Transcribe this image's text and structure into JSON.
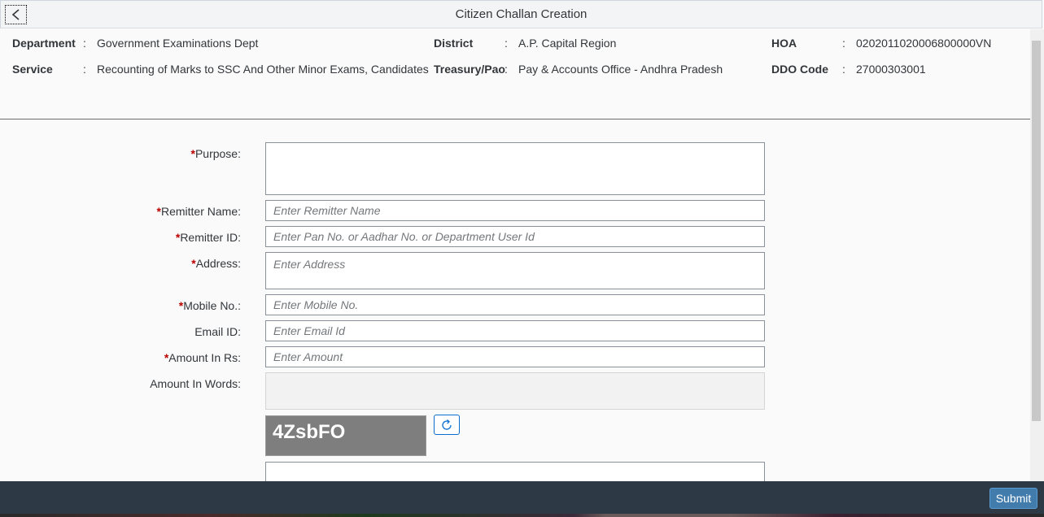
{
  "header": {
    "title": "Citizen Challan Creation"
  },
  "info": {
    "department": {
      "label": "Department",
      "value": "Government Examinations Dept"
    },
    "service": {
      "label": "Service",
      "value": "Recounting of Marks to SSC And Other Minor Exams, Candidates"
    },
    "district": {
      "label": "District",
      "value": "A.P. Capital Region"
    },
    "treasury": {
      "label": "Treasury/Pao",
      "value": "Pay & Accounts Office - Andhra Pradesh"
    },
    "hoa": {
      "label": "HOA",
      "value": "0202011020006800000VN"
    },
    "ddo": {
      "label": "DDO Code",
      "value": "27000303001"
    },
    "separator": ":"
  },
  "form": {
    "required_mark": "*",
    "purpose": {
      "label": "Purpose:",
      "value": "",
      "placeholder": ""
    },
    "remitter_name": {
      "label": "Remitter Name:",
      "value": "",
      "placeholder": "Enter Remitter Name"
    },
    "remitter_id": {
      "label": "Remitter ID:",
      "value": "",
      "placeholder": "Enter Pan No. or Aadhar No. or Department User Id"
    },
    "address": {
      "label": "Address:",
      "value": "",
      "placeholder": "Enter Address"
    },
    "mobile": {
      "label": "Mobile No.:",
      "value": "",
      "placeholder": "Enter Mobile No."
    },
    "email": {
      "label": "Email ID:",
      "value": "",
      "placeholder": "Enter Email Id"
    },
    "amount": {
      "label": "Amount In Rs:",
      "value": "",
      "placeholder": "Enter Amount"
    },
    "amount_words": {
      "label": "Amount In Words:",
      "value": ""
    },
    "captcha": {
      "text": "4ZsbFO",
      "input_value": ""
    }
  },
  "footer": {
    "submit_label": "Submit"
  },
  "icons": {
    "back": "chevron-left-icon",
    "refresh": "refresh-icon"
  },
  "colors": {
    "required": "#bb0000",
    "accent": "#0a6ed1",
    "submit_bg": "#427cac",
    "footer_bg": "#2d3a46"
  }
}
